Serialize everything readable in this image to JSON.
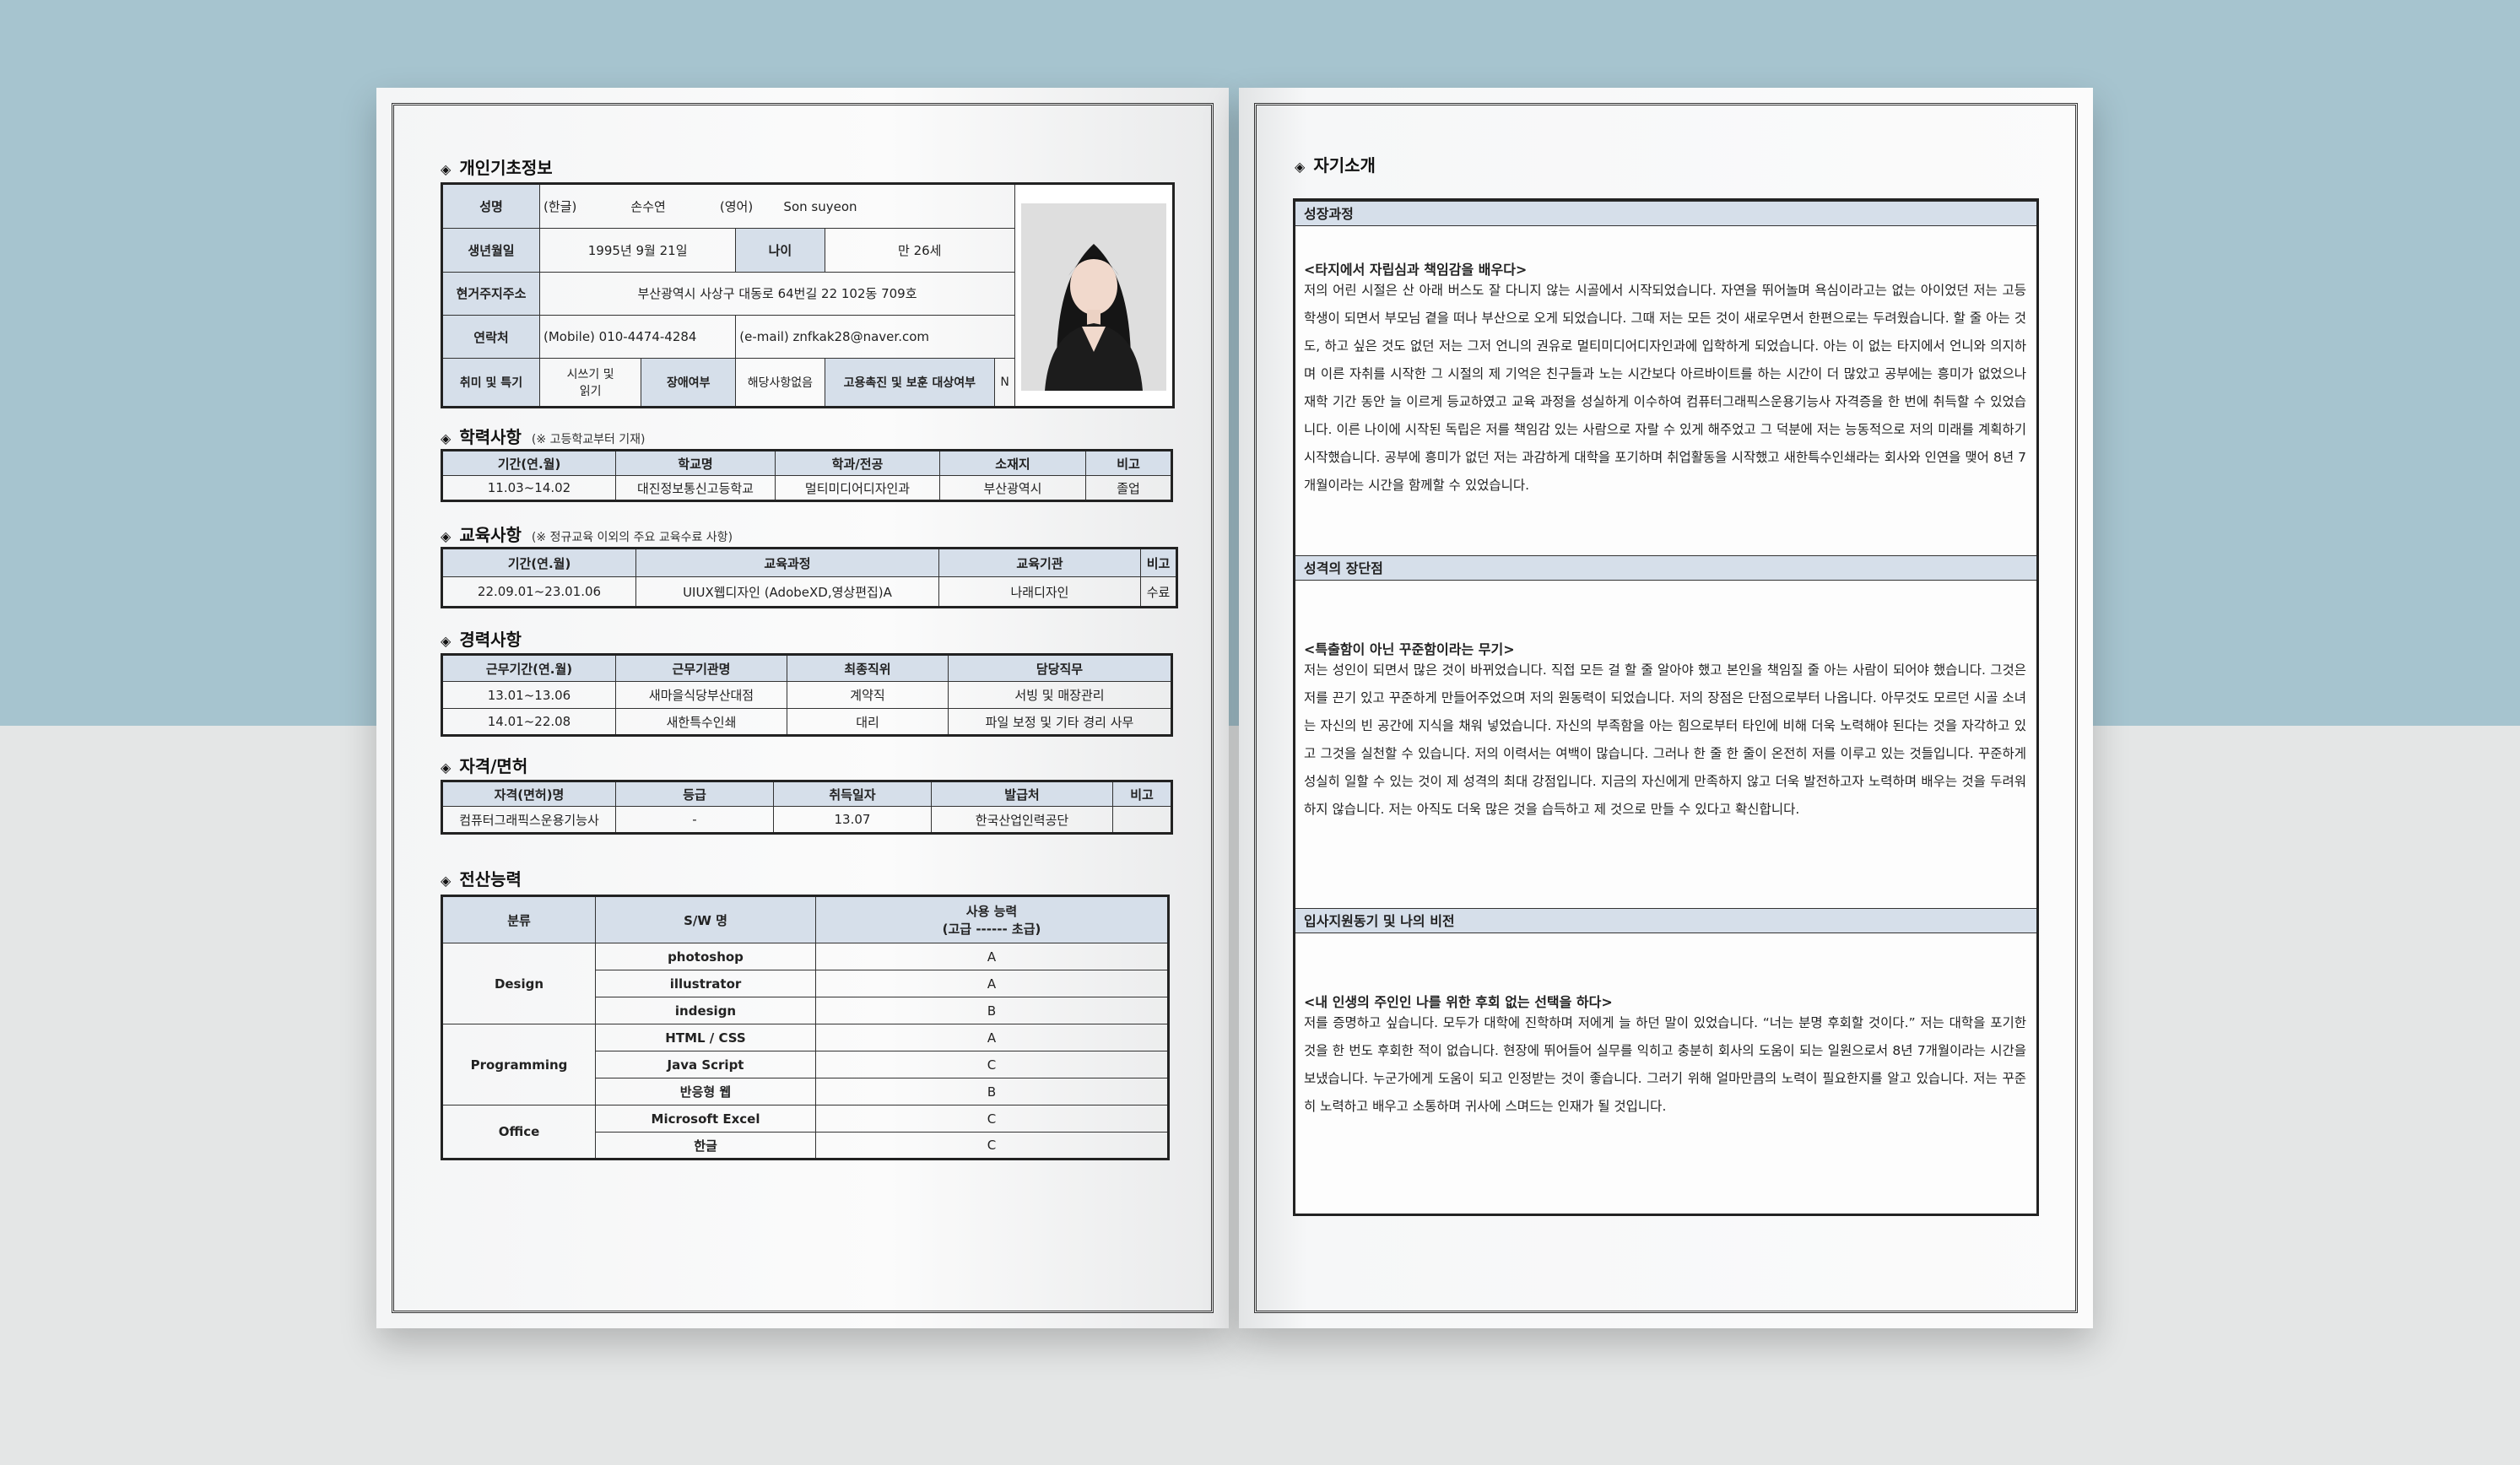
{
  "left": {
    "basic": {
      "title": "개인기초정보",
      "name_label": "성명",
      "name_kr_tag": "(한글)",
      "name_kr": "손수연",
      "name_en_tag": "(영어)",
      "name_en": "Son suyeon",
      "birth_label": "생년월일",
      "birth_value": "1995년 9월 21일",
      "age_label": "나이",
      "age_value": "만   26세",
      "address_label": "현거주지주소",
      "address_value": "부산광역시 사상구 대동로 64번길 22 102동 709호",
      "contact_label": "연락처",
      "mobile_value": "(Mobile)    010-4474-4284",
      "email_value": "(e-mail) znfkak28@naver.com",
      "hobby_label": "취미 및 특기",
      "hobby_value1": "시쓰기 및",
      "hobby_value2": "읽기",
      "disability_label": "장애여부",
      "disability_value": "해당사항없음",
      "employment_label": "고용촉진 및 보훈 대상여부",
      "employment_value": "N"
    },
    "education": {
      "title": "학력사항",
      "note": "(※ 고등학교부터 기재)",
      "headers": [
        "기간(연.월)",
        "학교명",
        "학과/전공",
        "소재지",
        "비고"
      ],
      "row": [
        "11.03~14.02",
        "대진정보통신고등학교",
        "멀티미디어디자인과",
        "부산광역시",
        "졸업"
      ]
    },
    "training": {
      "title": "교육사항",
      "note": "(※ 정규교육 이외의 주요 교육수료 사항)",
      "headers": [
        "기간(연.월)",
        "교육과정",
        "교육기관",
        "비고"
      ],
      "row": [
        "22.09.01~23.01.06",
        "UIUX웹디자인 (AdobeXD,영상편집)A",
        "나래디자인",
        "수료"
      ]
    },
    "career": {
      "title": "경력사항",
      "headers": [
        "근무기간(연.월)",
        "근무기관명",
        "최종직위",
        "담당직무"
      ],
      "rows": [
        [
          "13.01~13.06",
          "새마을식당부산대점",
          "계약직",
          "서빙 및 매장관리"
        ],
        [
          "14.01~22.08",
          "새한특수인쇄",
          "대리",
          "파일 보정 및 기타 경리 사무"
        ]
      ]
    },
    "license": {
      "title": "자격/면허",
      "headers": [
        "자격(면허)명",
        "등급",
        "취득일자",
        "발급처",
        "비고"
      ],
      "row": [
        "컴퓨터그래픽스운용기능사",
        "-",
        "13.07",
        "한국산업인력공단",
        ""
      ]
    },
    "computer": {
      "title": "전산능력",
      "h_category": "분류",
      "h_sw": "S/W 명",
      "h_level1": "사용 능력",
      "h_level2": "(고급 ------ 초급)",
      "groups": [
        {
          "category": "Design",
          "items": [
            [
              "photoshop",
              "A"
            ],
            [
              "illustrator",
              "A"
            ],
            [
              "indesign",
              "B"
            ]
          ]
        },
        {
          "category": "Programming",
          "items": [
            [
              "HTML / CSS",
              "A"
            ],
            [
              "Java Script",
              "C"
            ],
            [
              "반응형 웹",
              "B"
            ]
          ]
        },
        {
          "category": "Office",
          "items": [
            [
              "Microsoft Excel",
              "C"
            ],
            [
              "한글",
              "C"
            ]
          ]
        }
      ]
    }
  },
  "right": {
    "title": "자기소개",
    "sections": [
      {
        "header": "성장과정",
        "subtitle": "<타지에서 자립심과 책임감을 배우다>",
        "body": "저의 어린 시절은 산 아래 버스도 잘 다니지 않는 시골에서 시작되었습니다. 자연을 뛰어놀며 욕심이라고는 없는 아이었던 저는 고등학생이 되면서 부모님 곁을 떠나 부산으로 오게 되었습니다. 그때 저는 모든 것이 새로우면서 한편으로는 두려웠습니다. 할 줄 아는 것도, 하고 싶은 것도 없던 저는 그저 언니의 권유로 멀티미디어디자인과에 입학하게 되었습니다. 아는 이 없는 타지에서 언니와 의지하며 이른 자취를 시작한 그 시절의 제 기억은 친구들과 노는 시간보다 아르바이트를 하는 시간이 더 많았고 공부에는 흥미가 없었으나 재학 기간 동안 늘 이르게 등교하였고 교육 과정을 성실하게 이수하여 컴퓨터그래픽스운용기능사 자격증을 한 번에 취득할 수 있었습니다. 이른 나이에 시작된 독립은 저를 책임감 있는 사람으로 자랄 수 있게 해주었고 그 덕분에 저는 능동적으로 저의 미래를 계획하기 시작했습니다. 공부에 흥미가 없던 저는 과감하게 대학을 포기하며 취업활동을 시작했고 새한특수인쇄라는 회사와 인연을 맺어 8년 7개월이라는 시간을 함께할 수 있었습니다."
      },
      {
        "header": "성격의 장단점",
        "subtitle": "<특출함이 아닌 꾸준함이라는 무기>",
        "body": "저는 성인이 되면서 많은 것이 바뀌었습니다. 직접 모든 걸 할 줄 알아야 했고 본인을 책임질 줄 아는 사람이 되어야 했습니다. 그것은 저를 끈기 있고 꾸준하게 만들어주었으며 저의 원동력이 되었습니다. 저의 장점은 단점으로부터 나옵니다. 아무것도 모르던 시골 소녀는 자신의 빈 공간에 지식을 채워 넣었습니다. 자신의 부족함을 아는 힘으로부터 타인에 비해 더욱 노력해야 된다는 것을 자각하고 있고 그것을 실천할 수 있습니다. 저의 이력서는 여백이 많습니다. 그러나 한 줄 한 줄이 온전히 저를 이루고 있는 것들입니다. 꾸준하게 성실히 일할 수 있는 것이 제 성격의 최대 강점입니다. 지금의 자신에게 만족하지 않고 더욱 발전하고자 노력하며 배우는 것을 두려워하지 않습니다. 저는 아직도 더욱 많은 것을 습득하고 제 것으로 만들 수 있다고 확신합니다."
      },
      {
        "header": "입사지원동기 및 나의 비전",
        "subtitle": "<내 인생의 주인인 나를 위한 후회 없는 선택을 하다>",
        "body": " 저를 증명하고 싶습니다. 모두가 대학에 진학하며 저에게 늘 하던 말이 있었습니다. “너는 분명 후회할 것이다.” 저는 대학을 포기한 것을 한 번도 후회한 적이 없습니다. 현장에 뛰어들어 실무를 익히고 충분히 회사의 도움이 되는 일원으로서 8년 7개월이라는 시간을 보냈습니다. 누군가에게 도움이 되고 인정받는 것이 좋습니다. 그러기 위해 얼마만큼의 노력이 필요한지를 알고 있습니다. 저는 꾸준히 노력하고 배우고 소통하며 귀사에 스며드는 인재가 될 것입니다."
      }
    ]
  }
}
